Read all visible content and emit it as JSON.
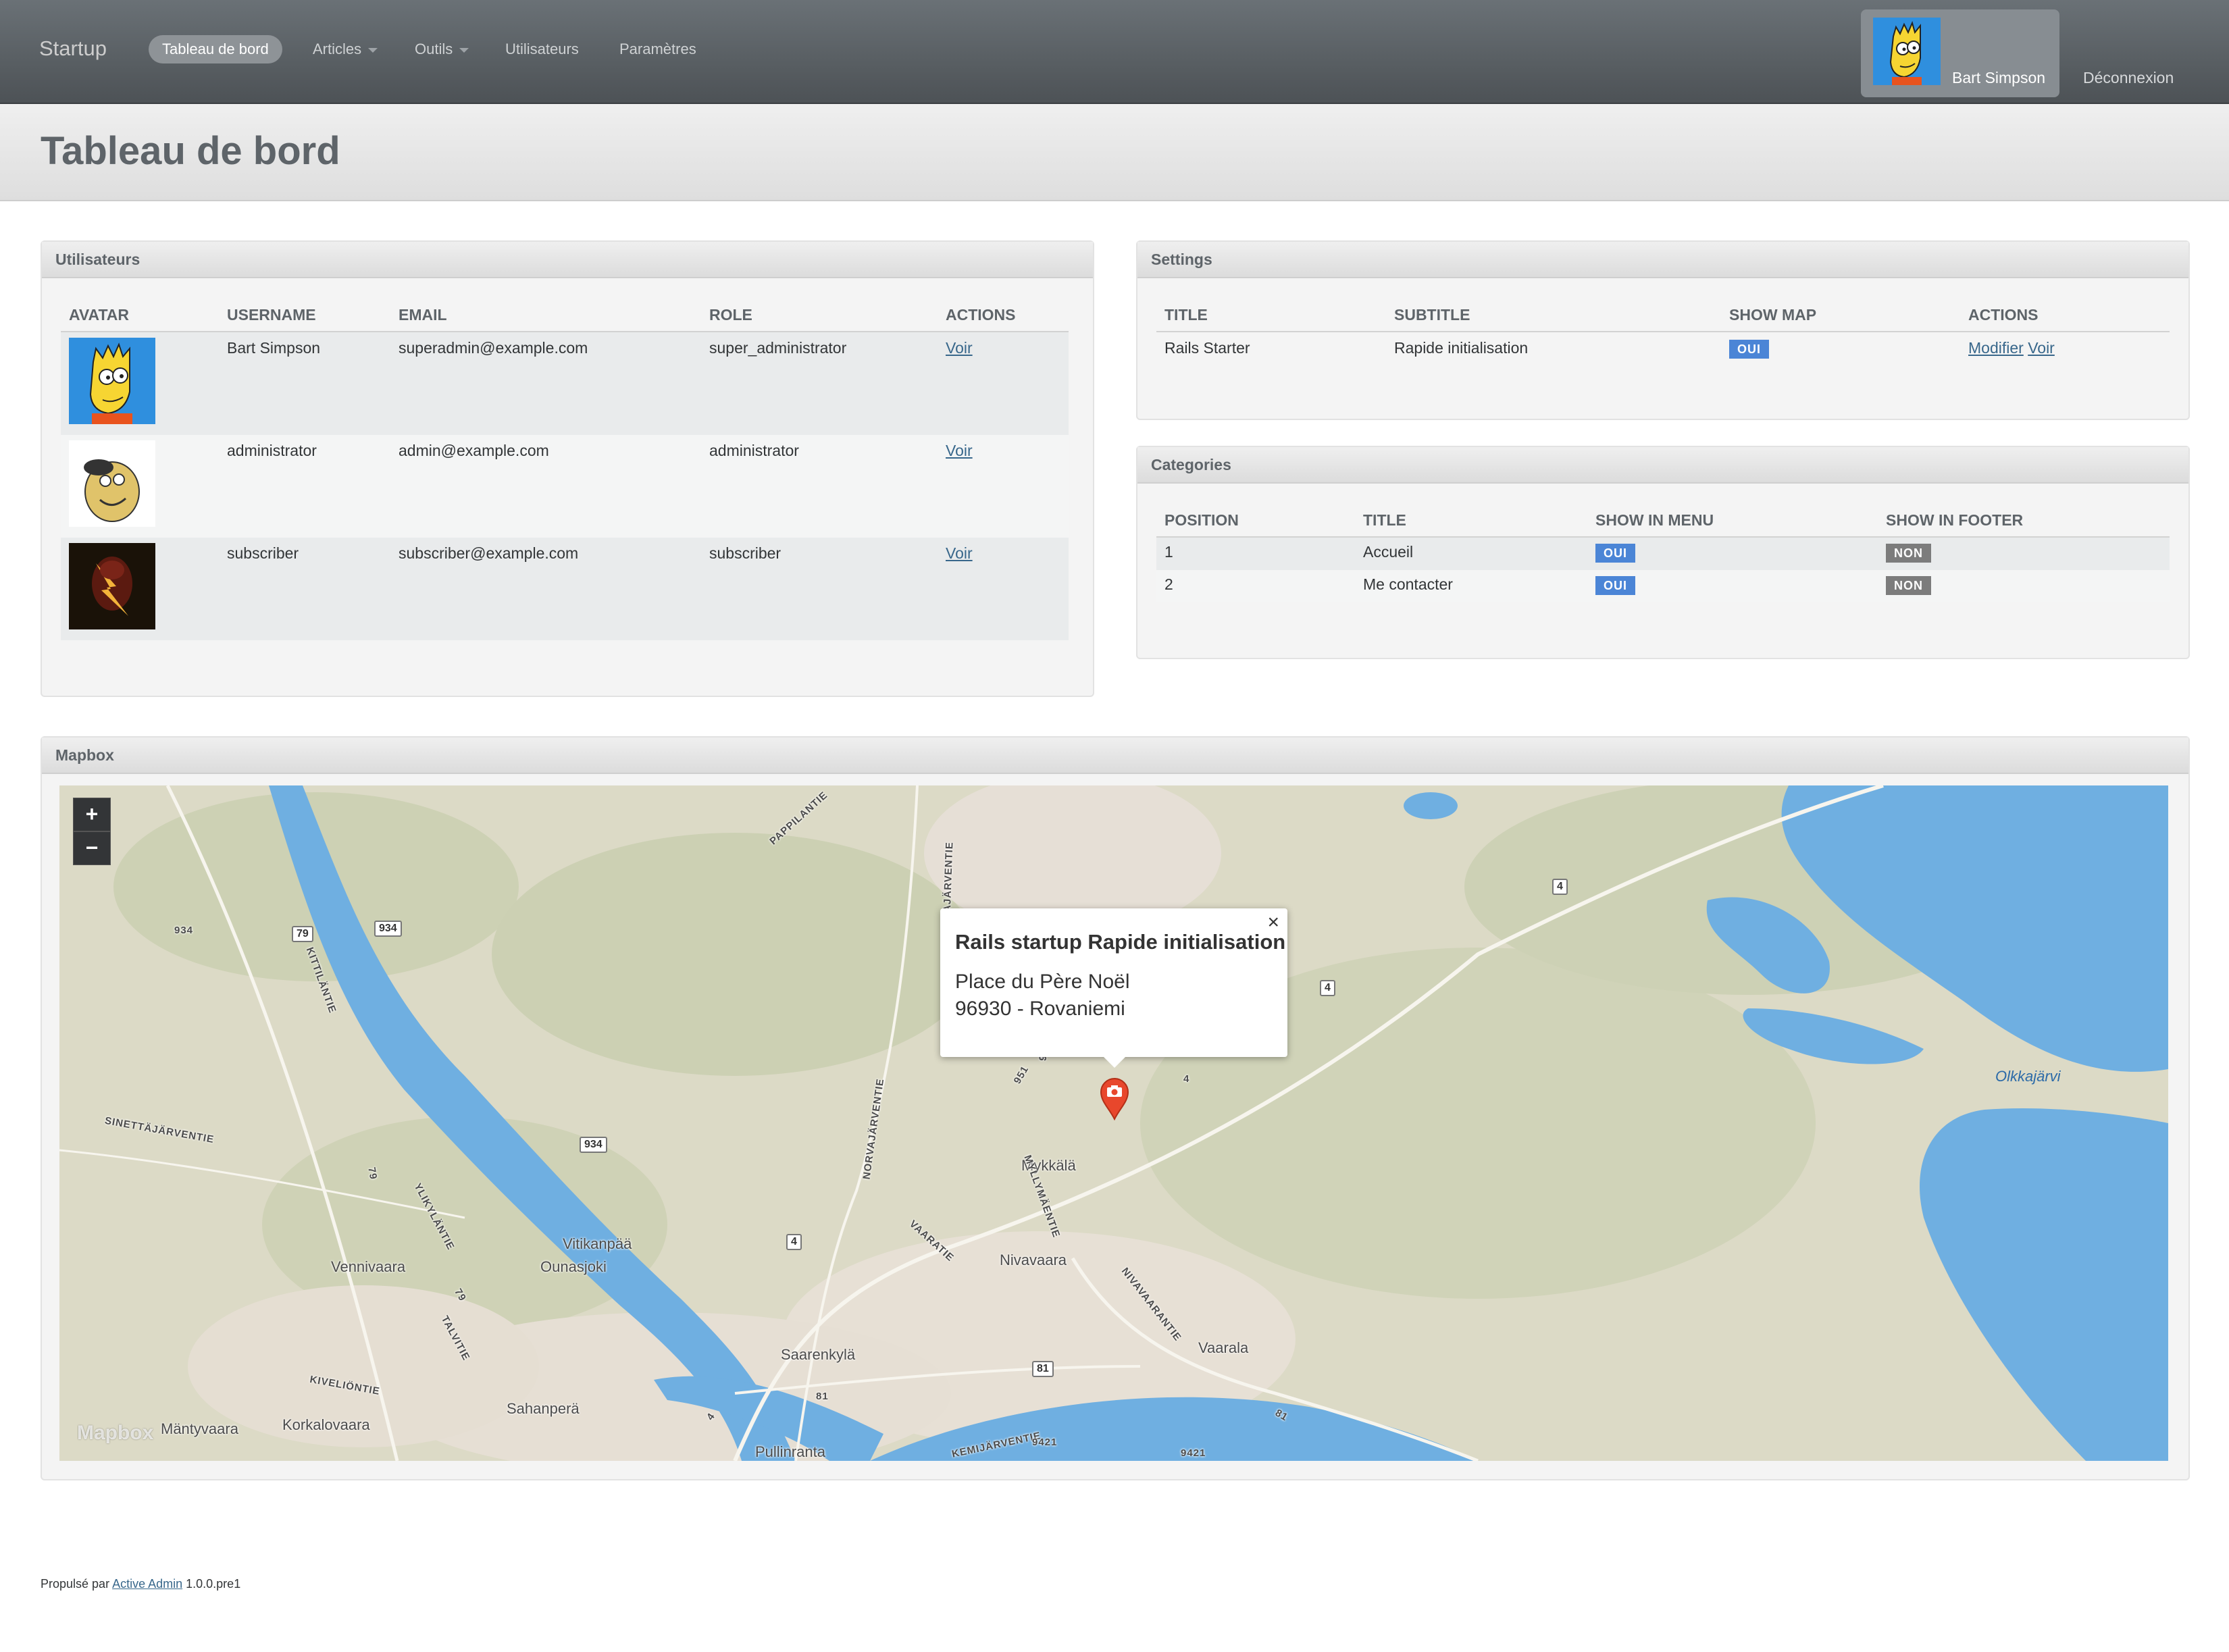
{
  "header": {
    "site_title": "Startup",
    "nav": [
      {
        "label": "Tableau de bord",
        "active": true,
        "has_menu": false
      },
      {
        "label": "Articles",
        "active": false,
        "has_menu": true
      },
      {
        "label": "Outils",
        "active": false,
        "has_menu": true
      },
      {
        "label": "Utilisateurs",
        "active": false,
        "has_menu": false
      },
      {
        "label": "Paramètres",
        "active": false,
        "has_menu": false
      }
    ],
    "current_user": "Bart Simpson",
    "logout": "Déconnexion"
  },
  "page": {
    "title": "Tableau de bord"
  },
  "users_panel": {
    "title": "Utilisateurs",
    "columns": [
      "AVATAR",
      "USERNAME",
      "EMAIL",
      "ROLE",
      "ACTIONS"
    ],
    "rows": [
      {
        "avatar": "bart-avatar",
        "username": "Bart Simpson",
        "email": "superadmin@example.com",
        "role": "super_administrator",
        "action": "Voir"
      },
      {
        "avatar": "dog-avatar",
        "username": "administrator",
        "email": "admin@example.com",
        "role": "administrator",
        "action": "Voir"
      },
      {
        "avatar": "flash-avatar",
        "username": "subscriber",
        "email": "subscriber@example.com",
        "role": "subscriber",
        "action": "Voir"
      }
    ]
  },
  "settings_panel": {
    "title": "Settings",
    "columns": [
      "TITLE",
      "SUBTITLE",
      "SHOW MAP",
      "ACTIONS"
    ],
    "row": {
      "title": "Rails Starter",
      "subtitle": "Rapide initialisation",
      "show_map": "OUI",
      "action_edit": "Modifier",
      "action_view": "Voir"
    }
  },
  "categories_panel": {
    "title": "Categories",
    "columns": [
      "POSITION",
      "TITLE",
      "SHOW IN MENU",
      "SHOW IN FOOTER"
    ],
    "rows": [
      {
        "position": "1",
        "title": "Accueil",
        "show_in_menu": "OUI",
        "show_in_footer": "NON"
      },
      {
        "position": "2",
        "title": "Me contacter",
        "show_in_menu": "OUI",
        "show_in_footer": "NON"
      }
    ]
  },
  "map_panel": {
    "title": "Mapbox",
    "zoom_in": "+",
    "zoom_out": "−",
    "popup": {
      "close": "×",
      "title": "Rails startup Rapide initialisation",
      "address_line1": "Place du Père Noël",
      "address_line2": "96930 - Rovaniemi"
    },
    "attribution_logo": "Mapbox",
    "lake_name": "Olkkajärvi",
    "places": [
      "Mykkälä",
      "Vitikanpää",
      "Ounasjoki",
      "Vennivaara",
      "Nivavaara",
      "Saarenkylä",
      "Vaarala",
      "Sahanperä",
      "Korkalovaara",
      "Mäntyvaara",
      "Pullinranta"
    ],
    "roads": [
      "PAPPILANTIE",
      "NORVAJÄRVENTIE",
      "KITTILÄNTIE",
      "SINETTÄJÄRVENTIE",
      "YLIKYLÄNTIE",
      "NORVAJÄRVENTIE",
      "MYLLYMÄENTIE",
      "VAARATIE",
      "NIVAVAARANTIE",
      "TALVITIE",
      "KIVELIÖNTIE",
      "KEMIJÄRVENTIE"
    ],
    "route_numbers": [
      "934",
      "79",
      "934",
      "4",
      "4",
      "951",
      "95",
      "4",
      "79",
      "79",
      "934",
      "4",
      "81",
      "81",
      "81",
      "9421",
      "9421",
      "4"
    ]
  },
  "footer": {
    "prefix": "Propulsé par",
    "link": "Active Admin",
    "version": "1.0.0.pre1"
  },
  "colors": {
    "header_top": "#6a7176",
    "header_bottom": "#4d5256",
    "badge_yes": "#4b85d6",
    "badge_no": "#7c7c7c",
    "link": "#38678b",
    "water": "#6fafe1",
    "land": "#d9d7c3",
    "marker": "#e8472c"
  }
}
